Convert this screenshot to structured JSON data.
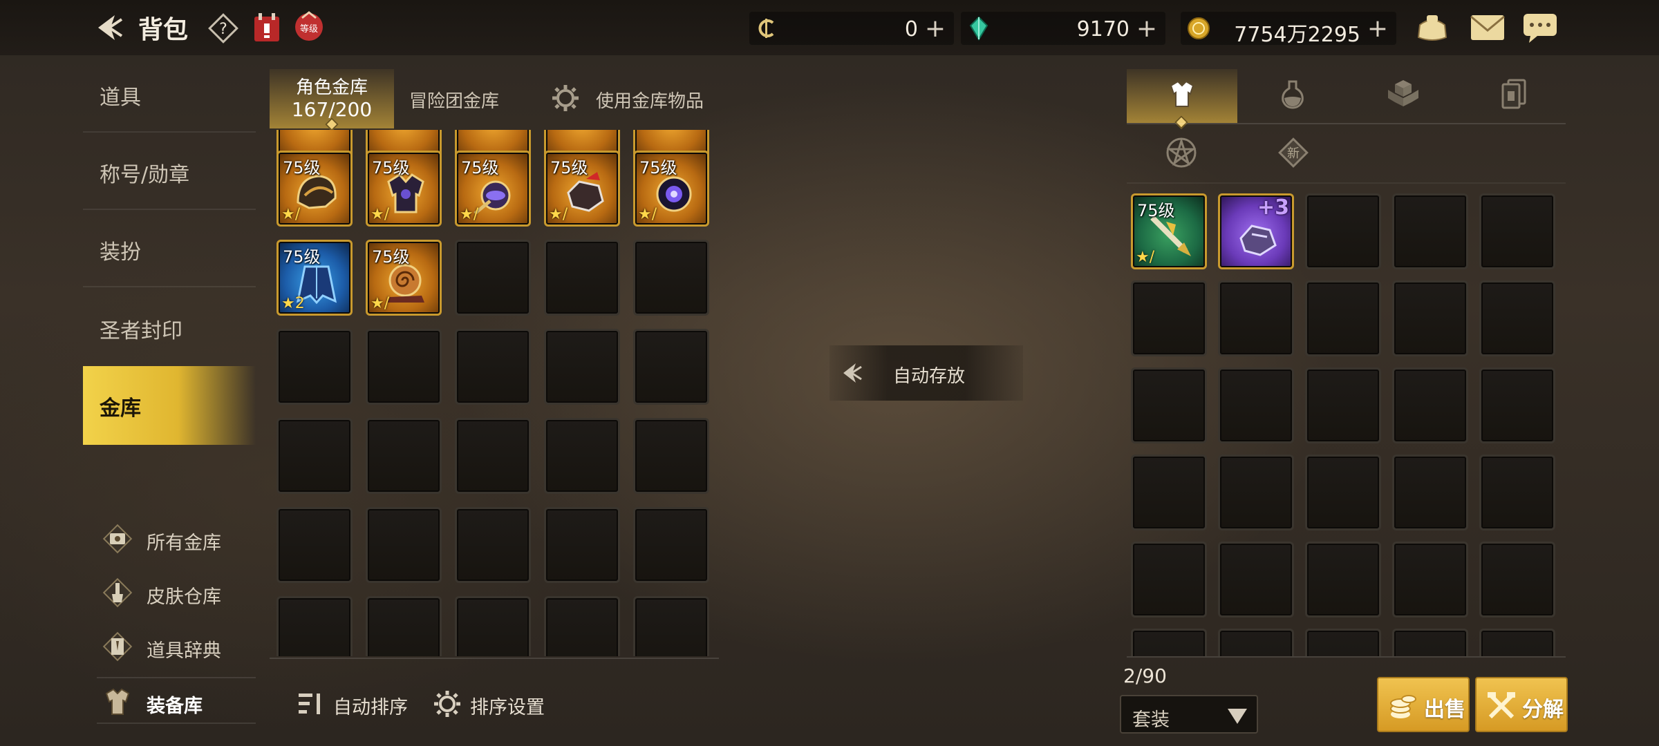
{
  "header": {
    "title": "背包",
    "currencies": [
      {
        "icon": "c-coin-icon",
        "value": "0"
      },
      {
        "icon": "green-crystal-icon",
        "value": "9170"
      },
      {
        "icon": "gold-coin-icon",
        "value": "7754万2295"
      }
    ],
    "plus": "+"
  },
  "sidebar": {
    "items": [
      {
        "label": "道具"
      },
      {
        "label": "称号/勋章"
      },
      {
        "label": "装扮"
      },
      {
        "label": "圣者封印"
      },
      {
        "label": "金库"
      }
    ],
    "sub_items": [
      {
        "label": "所有金库"
      },
      {
        "label": "皮肤仓库"
      },
      {
        "label": "道具辞典"
      },
      {
        "label": "装备库"
      }
    ]
  },
  "vault": {
    "tabs": [
      {
        "label": "角色金库",
        "count": "167/200"
      },
      {
        "label": "冒险团金库"
      },
      {
        "label": "使用金库物品"
      }
    ],
    "items": [
      {
        "level": "75级",
        "star": "★/",
        "color": "orange"
      },
      {
        "level": "75级",
        "star": "★/",
        "color": "orange"
      },
      {
        "level": "75级",
        "star": "★/",
        "color": "orange"
      },
      {
        "level": "75级",
        "star": "★/",
        "color": "orange"
      },
      {
        "level": "75级",
        "star": "★/",
        "color": "orange"
      },
      {
        "level": "75级",
        "star": "★2",
        "color": "blue"
      },
      {
        "level": "75级",
        "star": "★/",
        "color": "orange"
      }
    ],
    "auto_sort": "自动排序",
    "sort_settings": "排序设置"
  },
  "middle": {
    "auto_store": "自动存放"
  },
  "inventory": {
    "items": [
      {
        "level": "75级",
        "star": "★/",
        "color": "green"
      },
      {
        "plus": "+3",
        "color": "purple"
      }
    ],
    "count": "2/90",
    "filter": "套装",
    "sell": "出售",
    "dismantle": "分解"
  }
}
